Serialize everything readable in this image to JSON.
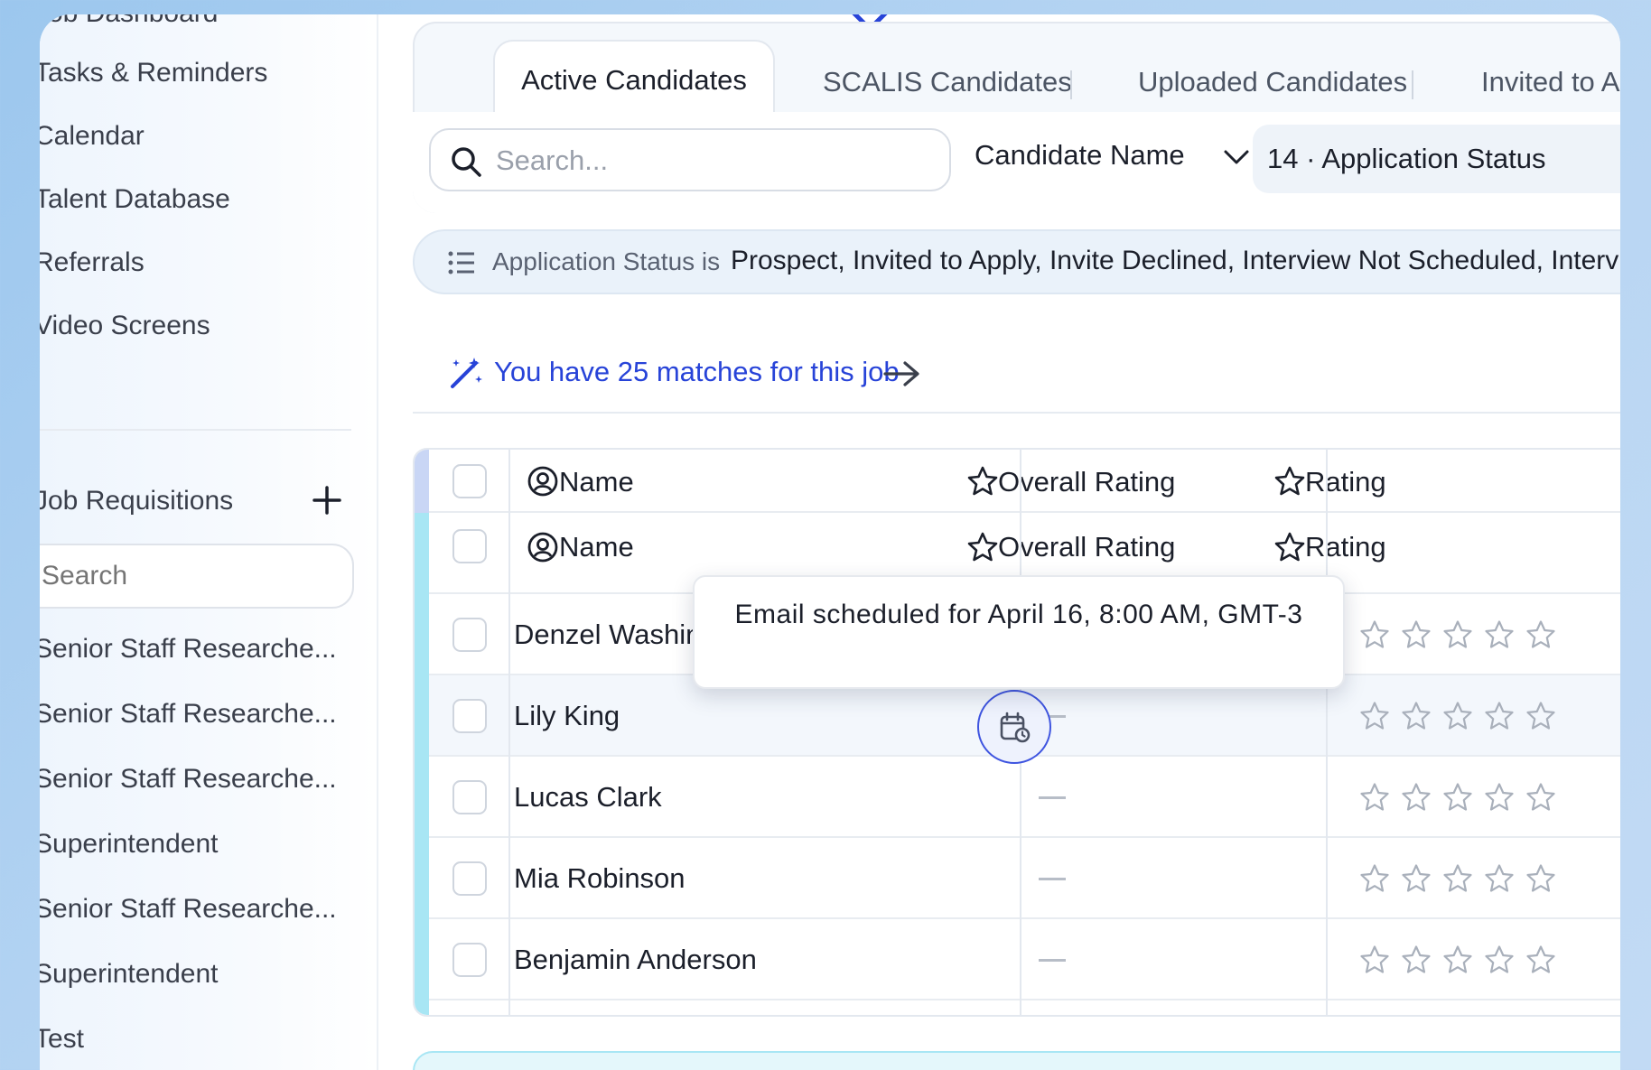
{
  "sidebar": {
    "items": [
      {
        "label": "Job Dashboard"
      },
      {
        "label": "Tasks & Reminders"
      },
      {
        "label": "Calendar"
      },
      {
        "label": "Talent Database"
      },
      {
        "label": "Referrals"
      },
      {
        "label": "Video Screens"
      }
    ],
    "job_requisitions_label": "Job Requisitions",
    "search_placeholder": "Search",
    "jobs": [
      {
        "label": "Senior Staff Researche..."
      },
      {
        "label": "Senior Staff Researche..."
      },
      {
        "label": "Senior Staff Researche..."
      },
      {
        "label": "Superintendent"
      },
      {
        "label": "Senior Staff Researche..."
      },
      {
        "label": "Superintendent"
      },
      {
        "label": "Test"
      }
    ]
  },
  "tabs": [
    {
      "label": "Active Candidates",
      "active": true
    },
    {
      "label": "SCALIS Candidates"
    },
    {
      "label": "Uploaded Candidates"
    },
    {
      "label": "Invited to Apply"
    }
  ],
  "filters": {
    "search_placeholder": "Search...",
    "column_select": "Candidate Name",
    "status_chip": "14 · Application Status",
    "banner_label": "Application Status is",
    "banner_values": "Prospect, Invited to Apply, Invite Declined, Interview Not Scheduled, Interview Scheduled"
  },
  "matches": {
    "text": "You have 25 matches for this job"
  },
  "table": {
    "headers": {
      "name": "Name",
      "overall_rating": "Overall Rating",
      "rating": "Rating"
    },
    "subheaders": {
      "name": "Name",
      "overall_rating": "Overall Rating",
      "rating": "Rating"
    },
    "rows": [
      {
        "name": "Denzel Washington",
        "overall_rating": "—",
        "stars": 0
      },
      {
        "name": "Lily King",
        "overall_rating": "—",
        "stars": 0
      },
      {
        "name": "Lucas Clark",
        "overall_rating": "—",
        "stars": 0
      },
      {
        "name": "Mia Robinson",
        "overall_rating": "—",
        "stars": 0
      },
      {
        "name": "Benjamin Anderson",
        "overall_rating": "—",
        "stars": 0
      }
    ]
  },
  "tooltip": {
    "text": "Email scheduled for April 16, 8:00 AM, GMT-3"
  },
  "colors": {
    "accent": "#2743d8",
    "stage_accent": "#a8e6f4"
  }
}
